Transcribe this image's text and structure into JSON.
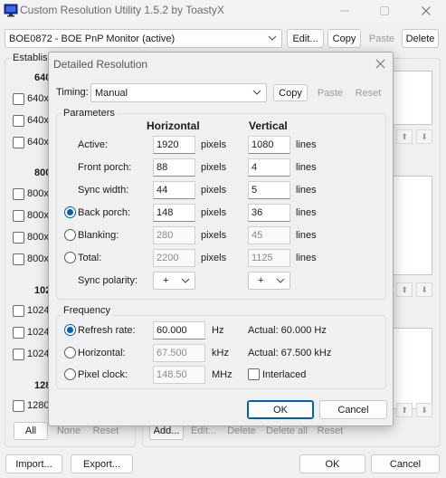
{
  "app": {
    "title": "Custom Resolution Utility 1.5.2 by ToastyX",
    "monitor_select": "BOE0872 - BOE PnP Monitor (active)",
    "edit_label": "Edit...",
    "copy_label": "Copy",
    "paste_label": "Paste",
    "delete_label": "Delete",
    "established_label": "Establis",
    "groups": [
      {
        "header": "640",
        "rows": [
          "640x",
          "640x",
          "640x"
        ]
      },
      {
        "header": "800",
        "rows": [
          "800x",
          "800x",
          "800x",
          "800x"
        ]
      },
      {
        "header": "102",
        "rows": [
          "1024",
          "1024",
          "1024"
        ]
      },
      {
        "header": "128",
        "rows": [
          "1280"
        ]
      }
    ],
    "all_label": "All",
    "none_label": "None",
    "reset_label": "Reset",
    "add_label": "Add...",
    "edit2_label": "Edit...",
    "delete2_label": "Delete",
    "delete_all_label": "Delete all",
    "reset2_label": "Reset",
    "import_label": "Import...",
    "export_label": "Export...",
    "ok_label": "OK",
    "cancel_label": "Cancel",
    "up_glyph": "⬆",
    "down_glyph": "⬇"
  },
  "dialog": {
    "title": "Detailed Resolution",
    "timing_label": "Timing:",
    "timing_value": "Manual",
    "copy_label": "Copy",
    "paste_label": "Paste",
    "reset_label": "Reset",
    "parameters_title": "Parameters",
    "horizontal_header": "Horizontal",
    "vertical_header": "Vertical",
    "rows": [
      {
        "label": "Active:",
        "h": "1920",
        "unit": "pixels",
        "v": "1080",
        "vunit": "lines",
        "radio": false,
        "disabled": false
      },
      {
        "label": "Front porch:",
        "h": "88",
        "unit": "pixels",
        "v": "4",
        "vunit": "lines",
        "radio": false,
        "disabled": false
      },
      {
        "label": "Sync width:",
        "h": "44",
        "unit": "pixels",
        "v": "5",
        "vunit": "lines",
        "radio": false,
        "disabled": false
      },
      {
        "label": "Back porch:",
        "h": "148",
        "unit": "pixels",
        "v": "36",
        "vunit": "lines",
        "radio": true,
        "selected": true,
        "disabled": false
      },
      {
        "label": "Blanking:",
        "h": "280",
        "unit": "pixels",
        "v": "45",
        "vunit": "lines",
        "radio": true,
        "selected": false,
        "disabled": true
      },
      {
        "label": "Total:",
        "h": "2200",
        "unit": "pixels",
        "v": "1125",
        "vunit": "lines",
        "radio": true,
        "selected": false,
        "disabled": true
      }
    ],
    "sync_polarity_label": "Sync polarity:",
    "h_polarity": "+",
    "v_polarity": "+",
    "frequency_title": "Frequency",
    "refresh_label": "Refresh rate:",
    "refresh_value": "60.000",
    "refresh_unit": "Hz",
    "refresh_actual": "Actual: 60.000 Hz",
    "horizontal_label": "Horizontal:",
    "horizontal_value": "67.500",
    "horizontal_unit": "kHz",
    "horizontal_actual": "Actual: 67.500 kHz",
    "pixelclock_label": "Pixel clock:",
    "pixelclock_value": "148.50",
    "pixelclock_unit": "MHz",
    "interlaced_label": "Interlaced",
    "ok_label": "OK",
    "cancel_label": "Cancel"
  },
  "colors": {
    "accent": "#005fb8",
    "window_bg": "#f0f0f0"
  }
}
